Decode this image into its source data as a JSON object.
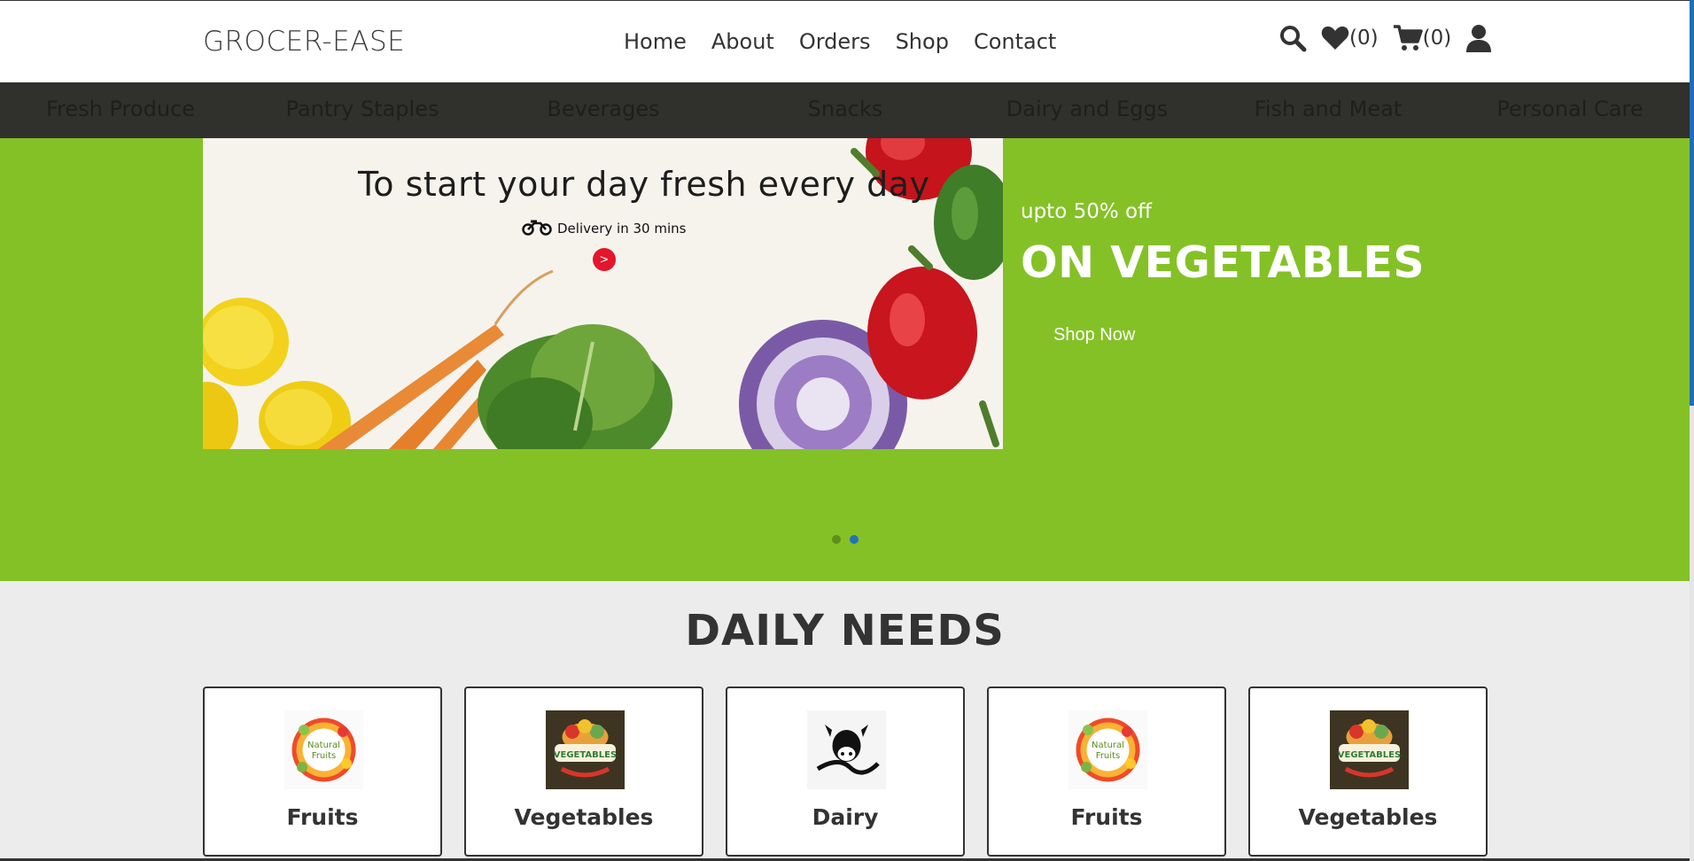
{
  "header": {
    "brand": "GROCER-EASE",
    "nav": [
      "Home",
      "About",
      "Orders",
      "Shop",
      "Contact"
    ],
    "wishlist_count": "(0)",
    "cart_count": "(0)"
  },
  "categories": [
    "Fresh Produce",
    "Pantry Staples",
    "Beverages",
    "Snacks",
    "Dairy and Eggs",
    "Fish and Meat",
    "Personal Care"
  ],
  "hero": {
    "slide_headline": "To start your day fresh every day",
    "slide_delivery": "Delivery in 30 mins",
    "slide_arrow": ">",
    "offer_small": "upto 50% off",
    "offer_big": "ON VEGETABLES",
    "shop_now": "Shop Now",
    "active_slide": 2,
    "slide_count": 2
  },
  "daily_needs": {
    "title": "DAILY NEEDS",
    "cards": [
      {
        "label": "Fruits",
        "logo_text": [
          "Natural",
          "Fruits"
        ]
      },
      {
        "label": "Vegetables",
        "logo_text": [
          "VEGETABLES"
        ]
      },
      {
        "label": "Dairy",
        "logo_text": []
      },
      {
        "label": "Fruits",
        "logo_text": [
          "Natural",
          "Fruits"
        ]
      },
      {
        "label": "Vegetables",
        "logo_text": [
          "VEGETABLES"
        ]
      }
    ]
  },
  "colors": {
    "hero_green": "#84c126",
    "category_bar": "#30302c",
    "sale_arrow": "#e3162b",
    "active_dot": "#1f73b9"
  },
  "icons": [
    "search-icon",
    "heart-icon",
    "cart-icon",
    "user-icon",
    "motorbike-icon"
  ]
}
